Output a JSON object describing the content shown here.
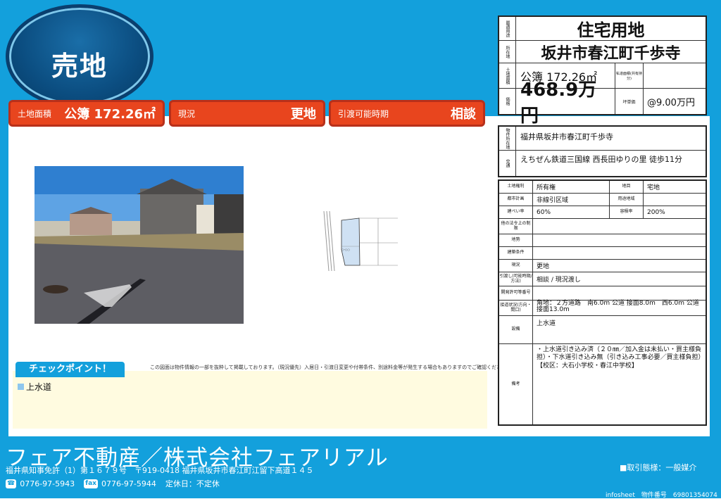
{
  "header": {
    "badge": "売地"
  },
  "info_bar": [
    {
      "label": "土地面積",
      "value": "公簿 172.26㎡"
    },
    {
      "label": "現況",
      "value": "更地"
    },
    {
      "label": "引渡可能時期",
      "value": "相談"
    }
  ],
  "summary": {
    "type_label": "最適用途",
    "type_value": "住宅用地",
    "loc_label": "所在地",
    "loc_value": "坂井市春江町千歩寺",
    "area_label": "土地面積",
    "area_value": "公簿 172.26㎡",
    "private_road_label": "私道面積(共有持分)",
    "private_road_value": "",
    "price_label": "価格",
    "price_value": "468.9万円",
    "tsubo_label": "坪単価",
    "tsubo_value": "@9.00万円"
  },
  "location": {
    "addr_label": "物件所在地",
    "addr_value": "福井県坂井市春江町千歩寺",
    "access_label": "交通",
    "access_value": "えちぜん鉄道三国線 西長田ゆりの里 徒歩11分"
  },
  "details": [
    {
      "l1": "土地権利",
      "v1": "所有権",
      "l2": "地目",
      "v2": "宅地"
    },
    {
      "l1": "都市計画",
      "v1": "非線引区域",
      "l2": "用途地域",
      "v2": ""
    },
    {
      "l1": "建ぺい率",
      "v1": "60%",
      "l2": "容積率",
      "v2": "200%"
    }
  ],
  "details_full": [
    {
      "l": "他の法令上の制限",
      "v": ""
    },
    {
      "l": "地勢",
      "v": ""
    },
    {
      "l": "建築条件",
      "v": ""
    },
    {
      "l": "現況",
      "v": "更地"
    },
    {
      "l": "引渡し(可能時期/方法)",
      "v": "相談 / 現況渡し"
    },
    {
      "l": "開発許可等番号",
      "v": ""
    },
    {
      "l": "接道状況(方向・間口)",
      "v": "角地：２方道路　南6.0m 公道 接面8.0m　西6.0m 公道 接面13.0m"
    },
    {
      "l": "設備",
      "v": "上水道"
    },
    {
      "l": "備考",
      "v": "・上水道引き込み済（２０㎜／加入金は未払い・買主様負担）・下水道引き込み無（引き込み工事必要／買主様負担）【校区：大石小学校・春江中学校】"
    }
  ],
  "map": {
    "lot_label": "○-○○"
  },
  "disclaimer": "この図面は物件情報の一部を抜粋して掲載しております。（現況優先）入居日・引渡日変更や付帯条件、別途料金等が発生する場合もありますのでご確認ください。",
  "checkpoint": {
    "title": "チェックポイント！",
    "items": [
      "上水道"
    ]
  },
  "footer": {
    "company": "フェア不動産／株式会社フェアリアル",
    "license": "福井県知事免許（1）第１６７９号　〒919-0418 福井県坂井市春江町江留下高道１４５",
    "tel_icon": "☎",
    "tel": "0776-97-5943",
    "fax_icon": "fax",
    "fax": "0776-97-5944",
    "holiday": "定休日：不定休",
    "transaction": "■取引態様：一般媒介",
    "sheet": "infosheet　物件番号　69801354074"
  }
}
